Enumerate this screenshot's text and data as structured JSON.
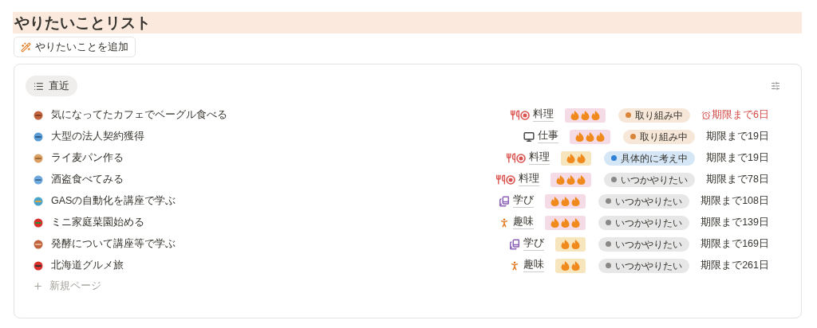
{
  "title": "やりたいことリスト",
  "add_button": "やりたいことを追加",
  "view_tab": {
    "label": "直近",
    "selected": true
  },
  "items": [
    {
      "name": "気になってたカフェでベーグル食べる",
      "category": {
        "kind": "cooking",
        "label": "料理"
      },
      "priority": {
        "kind": "high"
      },
      "status": {
        "label": "取り組み中",
        "color": "#d9853b"
      },
      "due": {
        "label": "期限まで6日",
        "urgent": true
      }
    },
    {
      "name": "大型の法人契約獲得",
      "category": {
        "kind": "work",
        "label": "仕事"
      },
      "priority": {
        "kind": "high"
      },
      "status": {
        "label": "取り組み中",
        "color": "#d9853b"
      },
      "due": {
        "label": "期限まで19日",
        "urgent": false
      }
    },
    {
      "name": "ライ麦パン作る",
      "category": {
        "kind": "cooking",
        "label": "料理"
      },
      "priority": {
        "kind": "medium"
      },
      "status": {
        "label": "具体的に考え中",
        "color": "#2f80d8"
      },
      "due": {
        "label": "期限まで19日",
        "urgent": false
      }
    },
    {
      "name": "酒盗食べてみる",
      "category": {
        "kind": "cooking",
        "label": "料理"
      },
      "priority": {
        "kind": "high"
      },
      "status": {
        "label": "いつかやりたい",
        "color": "#8a8886"
      },
      "due": {
        "label": "期限まで78日",
        "urgent": false
      }
    },
    {
      "name": "GASの自動化を講座で学ぶ",
      "category": {
        "kind": "study",
        "label": "学び"
      },
      "priority": {
        "kind": "high"
      },
      "status": {
        "label": "いつかやりたい",
        "color": "#8a8886"
      },
      "due": {
        "label": "期限まで108日",
        "urgent": false
      }
    },
    {
      "name": "ミニ家庭菜園始める",
      "category": {
        "kind": "hobby",
        "label": "趣味"
      },
      "priority": {
        "kind": "high"
      },
      "status": {
        "label": "いつかやりたい",
        "color": "#8a8886"
      },
      "due": {
        "label": "期限まで139日",
        "urgent": false
      }
    },
    {
      "name": "発酵について講座等で学ぶ",
      "category": {
        "kind": "study",
        "label": "学び"
      },
      "priority": {
        "kind": "medium"
      },
      "status": {
        "label": "いつかやりたい",
        "color": "#8a8886"
      },
      "due": {
        "label": "期限まで169日",
        "urgent": false
      }
    },
    {
      "name": "北海道グルメ旅",
      "category": {
        "kind": "hobby",
        "label": "趣味"
      },
      "priority": {
        "kind": "medium"
      },
      "status": {
        "label": "いつかやりたい",
        "color": "#8a8886"
      },
      "due": {
        "label": "期限まで261日",
        "urgent": false
      }
    }
  ],
  "new_page": "新規ページ"
}
